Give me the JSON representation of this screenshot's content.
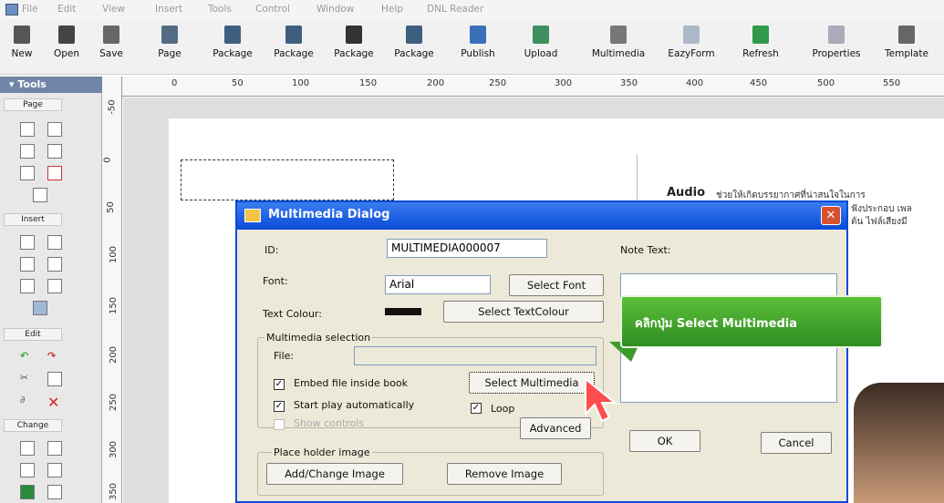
{
  "menubar": {
    "items": [
      "File",
      "Edit",
      "View",
      "Insert",
      "Tools",
      "Control",
      "Window",
      "Help",
      "DNL Reader"
    ]
  },
  "toolbar": {
    "buttons": [
      "New",
      "Open",
      "Save",
      "Page",
      "Package",
      "Package",
      "Package",
      "Package",
      "Publish",
      "Upload",
      "Multimedia",
      "EazyForm",
      "Refresh",
      "Properties",
      "Template"
    ]
  },
  "tools_panel": {
    "title": "▾ Tools",
    "sections": [
      "Page",
      "Insert",
      "Edit",
      "Change"
    ]
  },
  "ruler": {
    "horizontal": [
      "0",
      "50",
      "100",
      "150",
      "200",
      "250",
      "300",
      "350",
      "400",
      "450",
      "500",
      "550"
    ],
    "vertical": [
      "-50",
      "0",
      "50",
      "100",
      "150",
      "200",
      "250",
      "300",
      "350"
    ]
  },
  "document": {
    "audio_heading": "Audio",
    "audio_line1": "ช่วยให้เกิดบรรยากาศที่น่าสนใจในการ",
    "audio_line2": "ฟังประกอบ เพล",
    "audio_line3": "ต้น ไฟล์เสียงมี"
  },
  "dialog": {
    "title": "Multimedia Dialog",
    "close": "✕",
    "id_label": "ID:",
    "id_value": "MULTIMEDIA000007",
    "note_label": "Note Text:",
    "font_label": "Font:",
    "font_value": "Arial",
    "select_font": "Select Font",
    "text_colour_label": "Text Colour:",
    "select_text_colour": "Select TextColour",
    "multimedia_group": "Multimedia selection",
    "file_label": "File:",
    "embed_label": "Embed file inside book",
    "select_multimedia": "Select Multimedia",
    "start_play_label": "Start play automatically",
    "loop_label": "Loop",
    "show_controls_label": "Show controls",
    "advanced": "Advanced",
    "placeholder_group": "Place holder image",
    "add_change_image": "Add/Change Image",
    "remove_image": "Remove Image",
    "ok": "OK",
    "cancel": "Cancel"
  },
  "callout": {
    "text": "คลิกปุ่ม Select Multimedia"
  },
  "colors": {
    "title_bar": "#0A4BD8",
    "callout": "#3D9B2A",
    "close_button": "#D8512F"
  }
}
